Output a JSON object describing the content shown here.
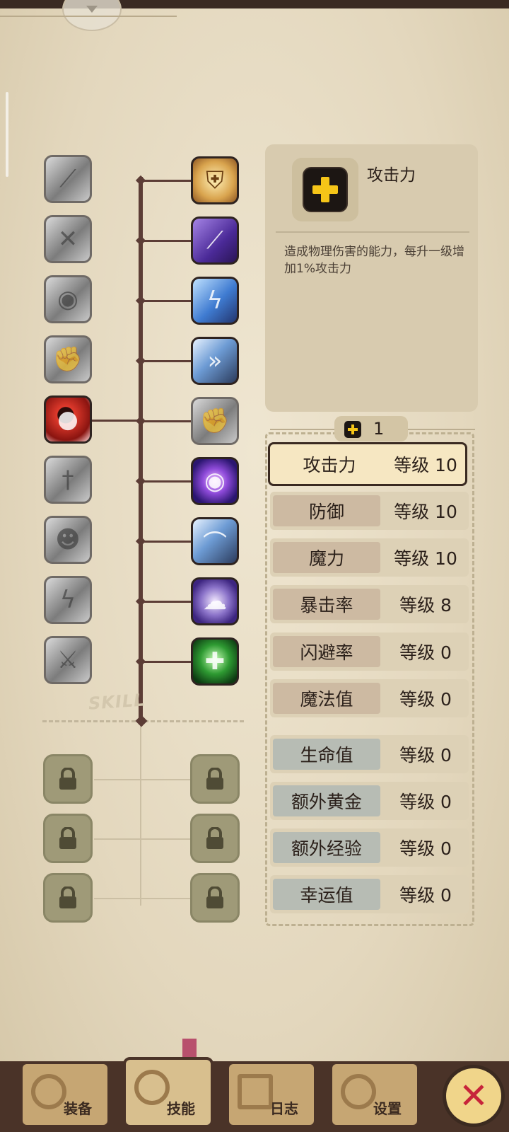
{
  "info_panel": {
    "title": "攻击力",
    "description": "造成物理伤害的能力，每升一级增加1%攻击力",
    "icon": "plus-icon"
  },
  "skill_points": {
    "value": "1",
    "icon": "plus-icon"
  },
  "skill_tree": {
    "stamp": "SKILL",
    "left_icons": [
      "sword-slash-icon",
      "kick-icon",
      "shout-icon",
      "fist-icon",
      "rage-face-icon",
      "dagger-icon",
      "dodge-icon",
      "lightning-strike-icon",
      "crossed-swords-icon"
    ],
    "right_icons": [
      "shield-icon",
      "purple-slash-icon",
      "lightning-icon",
      "dash-icon",
      "stone-fist-icon",
      "eye-icon",
      "blade-icon",
      "ghost-icon",
      "heal-icon"
    ],
    "locked_icons": [
      "lock-icon",
      "lock-icon",
      "lock-icon",
      "lock-icon",
      "lock-icon",
      "lock-icon"
    ]
  },
  "stats": [
    {
      "name": "攻击力",
      "level": "等级 10"
    },
    {
      "name": "防御",
      "level": "等级 10"
    },
    {
      "name": "魔力",
      "level": "等级 10"
    },
    {
      "name": "暴击率",
      "level": "等级 8"
    },
    {
      "name": "闪避率",
      "level": "等级 0"
    },
    {
      "name": "魔法值",
      "level": "等级 0"
    },
    {
      "name": "生命值",
      "level": "等级 0"
    },
    {
      "name": "额外黄金",
      "level": "等级 0"
    },
    {
      "name": "额外经验",
      "level": "等级 0"
    },
    {
      "name": "幸运值",
      "level": "等级 0"
    }
  ],
  "nav": {
    "equipment": "装备",
    "skills": "技能",
    "log": "日志",
    "settings": "设置",
    "close_icon": "close-icon"
  },
  "colors": {
    "accent_yellow": "#f5c518",
    "tree_line": "#5c3d36",
    "close_red": "#c7243a"
  }
}
